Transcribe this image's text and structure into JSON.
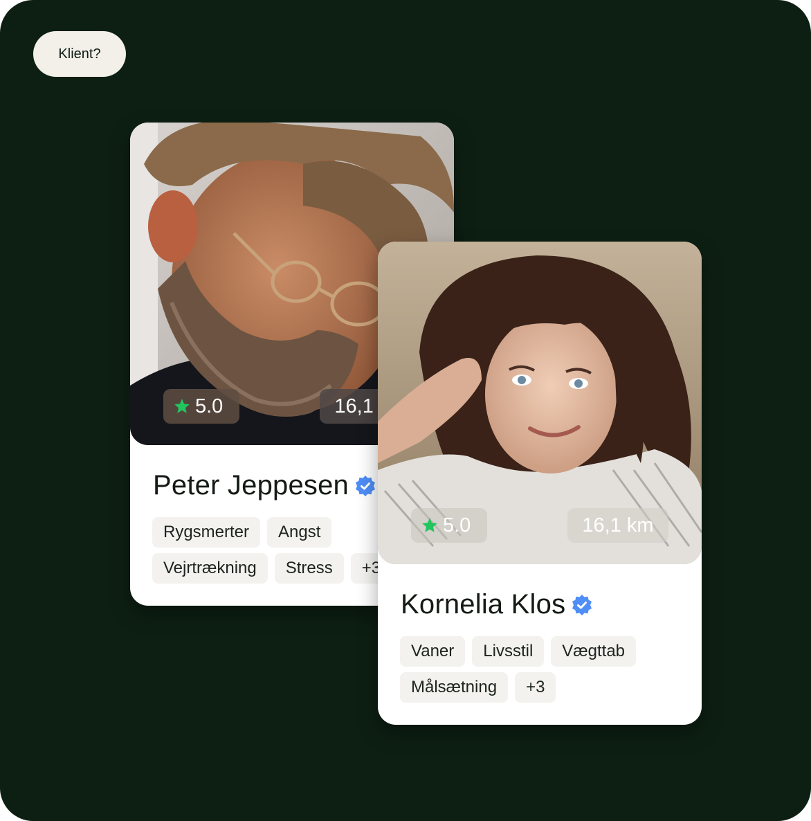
{
  "badge": {
    "label": "Klient?"
  },
  "cards": [
    {
      "name": "Peter Jeppesen",
      "rating": "5.0",
      "distance": "16,1 km",
      "tags": [
        "Rygsmerter",
        "Angst",
        "Vejrtrækning",
        "Stress",
        "+3"
      ]
    },
    {
      "name": "Kornelia Klos",
      "rating": "5.0",
      "distance": "16,1 km",
      "tags": [
        "Vaner",
        "Livsstil",
        "Vægttab",
        "Målsætning",
        "+3"
      ]
    }
  ],
  "colors": {
    "background": "#0d1f13",
    "star": "#22c55e",
    "verified": "#4f8ef7",
    "tag_bg": "#f3f2ef"
  }
}
